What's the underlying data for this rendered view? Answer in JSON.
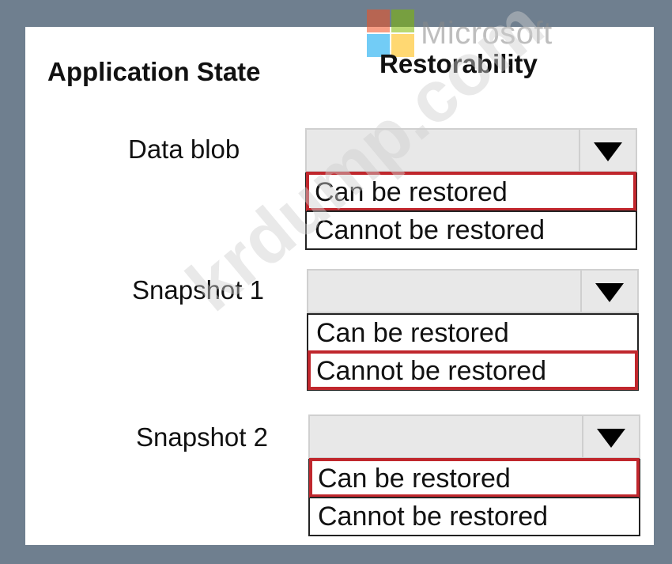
{
  "logo": {
    "text": "Microsoft",
    "colors": [
      "#f25022",
      "#7fba00",
      "#00a4ef",
      "#ffb900"
    ]
  },
  "headers": {
    "application_state": "Application State",
    "restorability": "Restorability"
  },
  "watermark": "krdump.com",
  "rows": [
    {
      "label": "Data blob",
      "options": [
        "Can be restored",
        "Cannot be restored"
      ],
      "selected_index": 0
    },
    {
      "label": "Snapshot 1",
      "options": [
        "Can be restored",
        "Cannot be restored"
      ],
      "selected_index": 1
    },
    {
      "label": "Snapshot 2",
      "options": [
        "Can be restored",
        "Cannot be restored"
      ],
      "selected_index": 0
    }
  ],
  "colors": {
    "panel_background": "#ffffff",
    "frame_background": "#6f7f8f",
    "select_background": "#e8e8e8",
    "selection_highlight": "#c0272d"
  },
  "icons": {
    "dropdown_arrow": "triangle-down-icon"
  }
}
